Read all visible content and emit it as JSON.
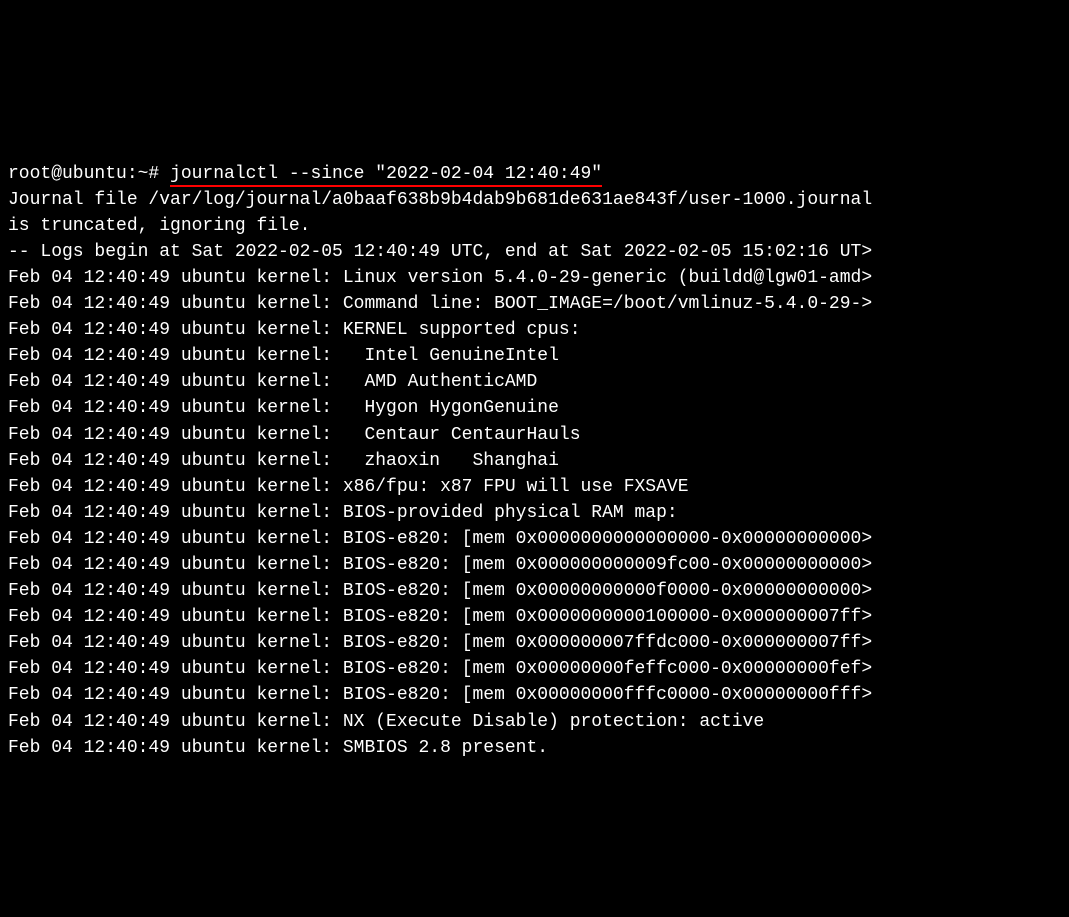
{
  "terminal": {
    "prompt": "root@ubuntu:~# ",
    "command": "journalctl --since \"2022-02-04 12:40:49\"",
    "lines": [
      "Journal file /var/log/journal/a0baaf638b9b4dab9b681de631ae843f/user-1000.journal",
      "is truncated, ignoring file.",
      "-- Logs begin at Sat 2022-02-05 12:40:49 UTC, end at Sat 2022-02-05 15:02:16 UT>",
      "Feb 04 12:40:49 ubuntu kernel: Linux version 5.4.0-29-generic (buildd@lgw01-amd>",
      "Feb 04 12:40:49 ubuntu kernel: Command line: BOOT_IMAGE=/boot/vmlinuz-5.4.0-29->",
      "Feb 04 12:40:49 ubuntu kernel: KERNEL supported cpus:",
      "Feb 04 12:40:49 ubuntu kernel:   Intel GenuineIntel",
      "Feb 04 12:40:49 ubuntu kernel:   AMD AuthenticAMD",
      "Feb 04 12:40:49 ubuntu kernel:   Hygon HygonGenuine",
      "Feb 04 12:40:49 ubuntu kernel:   Centaur CentaurHauls",
      "Feb 04 12:40:49 ubuntu kernel:   zhaoxin   Shanghai",
      "Feb 04 12:40:49 ubuntu kernel: x86/fpu: x87 FPU will use FXSAVE",
      "Feb 04 12:40:49 ubuntu kernel: BIOS-provided physical RAM map:",
      "Feb 04 12:40:49 ubuntu kernel: BIOS-e820: [mem 0x0000000000000000-0x00000000000>",
      "Feb 04 12:40:49 ubuntu kernel: BIOS-e820: [mem 0x000000000009fc00-0x00000000000>",
      "Feb 04 12:40:49 ubuntu kernel: BIOS-e820: [mem 0x00000000000f0000-0x00000000000>",
      "Feb 04 12:40:49 ubuntu kernel: BIOS-e820: [mem 0x0000000000100000-0x000000007ff>",
      "Feb 04 12:40:49 ubuntu kernel: BIOS-e820: [mem 0x000000007ffdc000-0x000000007ff>",
      "Feb 04 12:40:49 ubuntu kernel: BIOS-e820: [mem 0x00000000feffc000-0x00000000fef>",
      "Feb 04 12:40:49 ubuntu kernel: BIOS-e820: [mem 0x00000000fffc0000-0x00000000fff>",
      "Feb 04 12:40:49 ubuntu kernel: NX (Execute Disable) protection: active",
      "Feb 04 12:40:49 ubuntu kernel: SMBIOS 2.8 present."
    ]
  }
}
